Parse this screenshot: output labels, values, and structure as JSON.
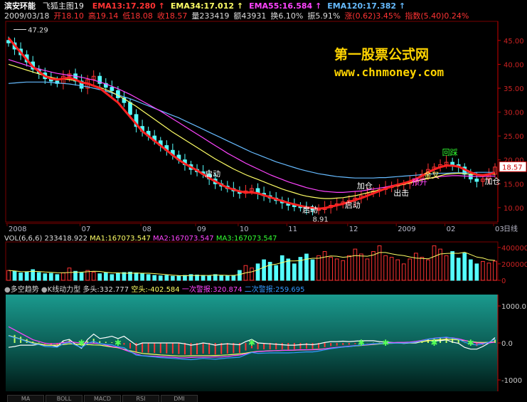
{
  "header": {
    "stock_name": "滨安环能",
    "indicator_name": "飞狐主图19",
    "ema_lines": [
      {
        "label": "EMA13:17.280",
        "color": "#ff3333"
      },
      {
        "label": "EMA34:17.012",
        "color": "#ffff66"
      },
      {
        "label": "EMA55:16.584",
        "color": "#ff44ff"
      },
      {
        "label": "EMA120:17.382",
        "color": "#66bbff"
      }
    ],
    "quote_items": [
      {
        "label": "2009/03/18",
        "color": "#dddddd"
      },
      {
        "label": "开18.10",
        "color": "#ff3333"
      },
      {
        "label": "高19.14",
        "color": "#ff3333"
      },
      {
        "label": "低18.08",
        "color": "#ff3333"
      },
      {
        "label": "收18.57",
        "color": "#ff3333"
      },
      {
        "label": "量233419",
        "color": "#dddddd"
      },
      {
        "label": "额43931",
        "color": "#dddddd"
      },
      {
        "label": "换6.10%",
        "color": "#dddddd"
      },
      {
        "label": "振5.91%",
        "color": "#dddddd"
      },
      {
        "label": "涨(0.62)3.45%",
        "color": "#ff3333"
      },
      {
        "label": "指数(5.40)0.24%",
        "color": "#ff3333"
      }
    ]
  },
  "watermark": {
    "line1": "第一股票公式网",
    "line2": "www.chnmoney.com"
  },
  "price_axis": {
    "labels": [
      "45.00",
      "40.00",
      "35.00",
      "30.00",
      "25.00",
      "20.00",
      "15.00",
      "10.00"
    ],
    "current": "18.57"
  },
  "time_axis": {
    "labels": [
      "2008",
      "07",
      "08",
      "09",
      "10",
      "11",
      "12",
      "2009",
      "02",
      "03"
    ],
    "unit_label": "日线"
  },
  "volume_header": {
    "text": "VOL(6,6,6) 233418.922",
    "ma1": "MA1:167073.547",
    "ma2": "MA2:167073.547",
    "ma3": "MA3:167073.547"
  },
  "volume_axis": [
    "400000",
    "200000",
    "0"
  ],
  "indicator_header": {
    "title": "多空趋势",
    "sub": "K线动力型",
    "bull": "多头:332.777",
    "bear": "空头:-402.584",
    "alert1": "一次警报:320.874",
    "alert2": "二次警报:259.695"
  },
  "indicator_axis": [
    "1000.0",
    "0.0",
    "-1000"
  ],
  "tabs": [
    "MA",
    "BOLL",
    "MACD",
    "RSI",
    "DMI"
  ],
  "chart_data": {
    "type": "line",
    "title": "",
    "ylim": [
      7,
      49
    ],
    "price_high_label": "47.29",
    "price_low_label": "8.91",
    "close": [
      44.5,
      43.2,
      42.0,
      40.5,
      39.0,
      38.2,
      37.0,
      36.5,
      36.0,
      37.5,
      38.0,
      36.5,
      35.0,
      36.8,
      37.5,
      36.0,
      35.2,
      34.5,
      33.0,
      32.0,
      29.5,
      27.0,
      26.0,
      25.0,
      24.0,
      23.0,
      22.0,
      21.0,
      20.0,
      19.0,
      18.0,
      17.5,
      17.0,
      16.0,
      15.0,
      14.5,
      14.0,
      13.5,
      13.0,
      13.5,
      14.0,
      13.0,
      12.5,
      12.0,
      11.5,
      11.0,
      10.5,
      10.2,
      10.0,
      9.8,
      9.5,
      9.6,
      10.0,
      10.5,
      10.8,
      11.2,
      11.5,
      12.0,
      12.5,
      13.0,
      13.5,
      13.8,
      14.2,
      14.5,
      14.8,
      15.0,
      15.5,
      16.0,
      17.0,
      18.0,
      18.5,
      19.0,
      19.5,
      19.0,
      18.5,
      17.0,
      16.0,
      15.5,
      16.0,
      17.0,
      18.5
    ],
    "ema13": [
      45.5,
      44.0,
      42.5,
      41.0,
      39.5,
      38.5,
      37.5,
      37.0,
      36.8,
      37.0,
      37.2,
      36.8,
      36.2,
      36.0,
      35.5,
      35.0,
      34.0,
      33.0,
      32.0,
      30.5,
      29.0,
      27.5,
      26.0,
      25.0,
      24.0,
      23.0,
      22.0,
      21.0,
      20.0,
      19.2,
      18.5,
      17.8,
      17.0,
      16.2,
      15.5,
      14.8,
      14.2,
      13.8,
      13.4,
      13.2,
      13.2,
      13.0,
      12.6,
      12.2,
      11.8,
      11.4,
      11.0,
      10.7,
      10.4,
      10.1,
      9.9,
      9.8,
      9.9,
      10.2,
      10.5,
      10.8,
      11.2,
      11.6,
      12.0,
      12.5,
      13.0,
      13.5,
      14.0,
      14.4,
      14.8,
      15.1,
      15.5,
      16.0,
      16.7,
      17.4,
      18.0,
      18.5,
      18.8,
      18.8,
      18.6,
      18.0,
      17.4,
      16.9,
      16.8,
      17.0,
      17.3
    ],
    "ema34": [
      40.0,
      39.6,
      39.2,
      38.8,
      38.4,
      38.0,
      37.6,
      37.3,
      37.0,
      36.9,
      36.8,
      36.6,
      36.3,
      36.0,
      35.6,
      35.2,
      34.7,
      34.2,
      33.5,
      32.8,
      32.0,
      31.2,
      30.3,
      29.4,
      28.5,
      27.6,
      26.7,
      25.8,
      25.0,
      24.2,
      23.4,
      22.6,
      21.8,
      21.0,
      20.2,
      19.5,
      18.8,
      18.1,
      17.5,
      16.9,
      16.4,
      15.9,
      15.4,
      14.9,
      14.4,
      13.9,
      13.5,
      13.1,
      12.7,
      12.4,
      12.2,
      12.0,
      11.9,
      11.9,
      12.0,
      12.1,
      12.3,
      12.5,
      12.8,
      13.1,
      13.4,
      13.7,
      14.0,
      14.3,
      14.6,
      14.9,
      15.2,
      15.5,
      15.8,
      16.1,
      16.4,
      16.7,
      17.0,
      17.1,
      17.2,
      17.1,
      17.0,
      16.9,
      16.9,
      17.0,
      17.0
    ],
    "ema55": [
      41.0,
      40.6,
      40.2,
      39.8,
      39.4,
      39.0,
      38.7,
      38.4,
      38.1,
      37.9,
      37.7,
      37.5,
      37.3,
      37.0,
      36.7,
      36.3,
      35.9,
      35.4,
      34.9,
      34.3,
      33.7,
      33.0,
      32.3,
      31.6,
      30.9,
      30.2,
      29.4,
      28.6,
      27.8,
      27.0,
      26.2,
      25.4,
      24.6,
      23.8,
      23.0,
      22.2,
      21.4,
      20.7,
      20.0,
      19.3,
      18.7,
      18.1,
      17.5,
      16.9,
      16.4,
      15.9,
      15.4,
      15.0,
      14.6,
      14.2,
      13.9,
      13.6,
      13.4,
      13.3,
      13.2,
      13.2,
      13.3,
      13.4,
      13.5,
      13.7,
      13.9,
      14.1,
      14.3,
      14.6,
      14.9,
      15.1,
      15.4,
      15.6,
      15.9,
      16.1,
      16.3,
      16.5,
      16.6,
      16.7,
      16.7,
      16.6,
      16.6,
      16.5,
      16.5,
      16.6,
      16.6
    ],
    "ema120": [
      36.0,
      36.1,
      36.2,
      36.3,
      36.3,
      36.3,
      36.3,
      36.2,
      36.1,
      36.0,
      35.9,
      35.7,
      35.5,
      35.3,
      35.0,
      34.7,
      34.4,
      34.0,
      33.6,
      33.2,
      32.8,
      32.3,
      31.8,
      31.3,
      30.8,
      30.3,
      29.8,
      29.3,
      28.8,
      28.2,
      27.6,
      27.0,
      26.4,
      25.8,
      25.2,
      24.6,
      24.0,
      23.4,
      22.8,
      22.2,
      21.6,
      21.1,
      20.6,
      20.1,
      19.6,
      19.2,
      18.8,
      18.4,
      18.0,
      17.7,
      17.4,
      17.1,
      16.9,
      16.7,
      16.5,
      16.4,
      16.3,
      16.2,
      16.2,
      16.2,
      16.2,
      16.3,
      16.3,
      16.4,
      16.5,
      16.6,
      16.7,
      16.8,
      16.9,
      17.0,
      17.1,
      17.2,
      17.2,
      17.3,
      17.3,
      17.3,
      17.3,
      17.4,
      17.4,
      17.4,
      17.4
    ],
    "annotations": [
      {
        "text": "启动",
        "i": 33,
        "price": 16.5,
        "color": "#ffffff"
      },
      {
        "text": "启动",
        "i": 49,
        "price": 9.0,
        "color": "#ffffff"
      },
      {
        "text": "启动",
        "i": 56,
        "price": 10.0,
        "color": "#ffffff"
      },
      {
        "text": "加仓",
        "i": 58,
        "price": 14.0,
        "color": "#ffffff"
      },
      {
        "text": "出击",
        "i": 64,
        "price": 12.5,
        "color": "#ffffff"
      },
      {
        "text": "预升",
        "i": 67,
        "price": 14.8,
        "color": "#ff44ff"
      },
      {
        "text": "金叉",
        "i": 69,
        "price": 16.2,
        "color": "#ffff66"
      },
      {
        "text": "回踩",
        "i": 72,
        "price": 21.0,
        "color": "#33ff33"
      },
      {
        "text": "加仓",
        "i": 79,
        "price": 15.0,
        "color": "#ffffff"
      }
    ],
    "volume_series": [
      120000,
      110000,
      90000,
      100000,
      130000,
      95000,
      80000,
      85000,
      70000,
      90000,
      150000,
      110000,
      90000,
      120000,
      100000,
      80000,
      90000,
      70000,
      85000,
      95000,
      100000,
      90000,
      80000,
      70000,
      60000,
      55000,
      60000,
      50000,
      55000,
      60000,
      70000,
      65000,
      60000,
      55000,
      70000,
      60000,
      55000,
      60000,
      120000,
      180000,
      150000,
      200000,
      250000,
      220000,
      180000,
      300000,
      260000,
      200000,
      280000,
      320000,
      250000,
      300000,
      350000,
      280000,
      260000,
      240000,
      300000,
      380000,
      320000,
      260000,
      350000,
      420000,
      300000,
      280000,
      250000,
      200000,
      260000,
      330000,
      280000,
      250000,
      420000,
      380000,
      300000,
      350000,
      270000,
      330000,
      250000,
      200000,
      230000,
      210000,
      233419
    ]
  }
}
